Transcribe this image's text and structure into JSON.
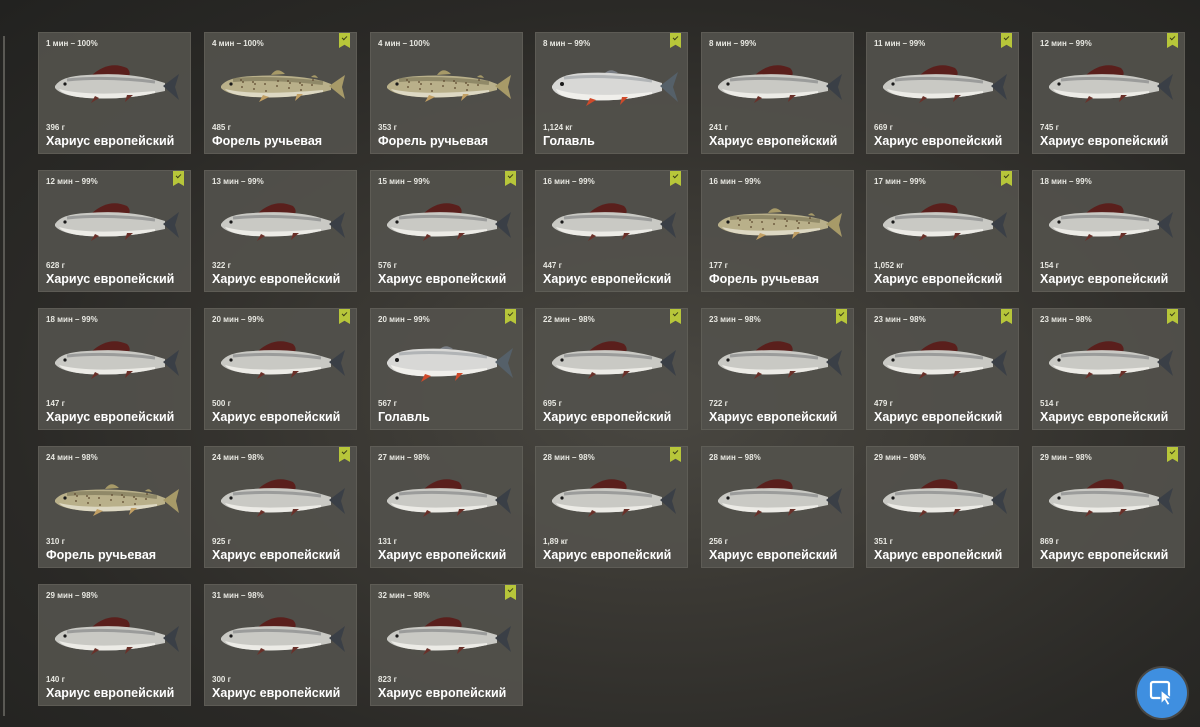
{
  "catch_list": {
    "cards": [
      {
        "time": "1 мин – 100%",
        "weight": "396 г",
        "name": "Хариус европейский",
        "species": "grayling",
        "checked": false
      },
      {
        "time": "4 мин – 100%",
        "weight": "485 г",
        "name": "Форель ручьевая",
        "species": "trout",
        "checked": true
      },
      {
        "time": "4 мин – 100%",
        "weight": "353 г",
        "name": "Форель ручьевая",
        "species": "trout",
        "checked": false
      },
      {
        "time": "8 мин – 99%",
        "weight": "1,124 кг",
        "name": "Голавль",
        "species": "chub",
        "checked": true
      },
      {
        "time": "8 мин – 99%",
        "weight": "241 г",
        "name": "Хариус европейский",
        "species": "grayling",
        "checked": false
      },
      {
        "time": "11 мин – 99%",
        "weight": "669 г",
        "name": "Хариус европейский",
        "species": "grayling",
        "checked": true
      },
      {
        "time": "12 мин – 99%",
        "weight": "745 г",
        "name": "Хариус европейский",
        "species": "grayling",
        "checked": true
      },
      {
        "time": "12 мин – 99%",
        "weight": "628 г",
        "name": "Хариус европейский",
        "species": "grayling",
        "checked": true
      },
      {
        "time": "13 мин – 99%",
        "weight": "322 г",
        "name": "Хариус европейский",
        "species": "grayling",
        "checked": false
      },
      {
        "time": "15 мин – 99%",
        "weight": "576 г",
        "name": "Хариус европейский",
        "species": "grayling",
        "checked": true
      },
      {
        "time": "16 мин – 99%",
        "weight": "447 г",
        "name": "Хариус европейский",
        "species": "grayling",
        "checked": true
      },
      {
        "time": "16 мин – 99%",
        "weight": "177 г",
        "name": "Форель ручьевая",
        "species": "trout",
        "checked": false
      },
      {
        "time": "17 мин – 99%",
        "weight": "1,052 кг",
        "name": "Хариус европейский",
        "species": "grayling",
        "checked": true
      },
      {
        "time": "18 мин – 99%",
        "weight": "154 г",
        "name": "Хариус европейский",
        "species": "grayling",
        "checked": false
      },
      {
        "time": "18 мин – 99%",
        "weight": "147 г",
        "name": "Хариус европейский",
        "species": "grayling",
        "checked": false
      },
      {
        "time": "20 мин – 99%",
        "weight": "500 г",
        "name": "Хариус европейский",
        "species": "grayling",
        "checked": true
      },
      {
        "time": "20 мин – 99%",
        "weight": "567 г",
        "name": "Голавль",
        "species": "chub",
        "checked": true
      },
      {
        "time": "22 мин – 98%",
        "weight": "695 г",
        "name": "Хариус европейский",
        "species": "grayling",
        "checked": true
      },
      {
        "time": "23 мин – 98%",
        "weight": "722 г",
        "name": "Хариус европейский",
        "species": "grayling",
        "checked": true
      },
      {
        "time": "23 мин – 98%",
        "weight": "479 г",
        "name": "Хариус европейский",
        "species": "grayling",
        "checked": true
      },
      {
        "time": "23 мин – 98%",
        "weight": "514 г",
        "name": "Хариус европейский",
        "species": "grayling",
        "checked": true
      },
      {
        "time": "24 мин – 98%",
        "weight": "310 г",
        "name": "Форель ручьевая",
        "species": "trout",
        "checked": false
      },
      {
        "time": "24 мин – 98%",
        "weight": "925 г",
        "name": "Хариус европейский",
        "species": "grayling",
        "checked": true
      },
      {
        "time": "27 мин – 98%",
        "weight": "131 г",
        "name": "Хариус европейский",
        "species": "grayling",
        "checked": false
      },
      {
        "time": "28 мин – 98%",
        "weight": "1,89 кг",
        "name": "Хариус европейский",
        "species": "grayling",
        "checked": true
      },
      {
        "time": "28 мин – 98%",
        "weight": "256 г",
        "name": "Хариус европейский",
        "species": "grayling",
        "checked": false
      },
      {
        "time": "29 мин – 98%",
        "weight": "351 г",
        "name": "Хариус европейский",
        "species": "grayling",
        "checked": false
      },
      {
        "time": "29 мин – 98%",
        "weight": "869 г",
        "name": "Хариус европейский",
        "species": "grayling",
        "checked": true
      },
      {
        "time": "29 мин – 98%",
        "weight": "140 г",
        "name": "Хариус европейский",
        "species": "grayling",
        "checked": false
      },
      {
        "time": "31 мин – 98%",
        "weight": "300 г",
        "name": "Хариус европейский",
        "species": "grayling",
        "checked": false
      },
      {
        "time": "32 мин – 98%",
        "weight": "823 г",
        "name": "Хариус европейский",
        "species": "grayling",
        "checked": true
      }
    ]
  },
  "colors": {
    "card_bg": "#52514c",
    "check_badge": "#b7c63a",
    "cursor_button": "#3f8fe0"
  },
  "cursor_button": {
    "icon": "cursor-select-icon"
  }
}
